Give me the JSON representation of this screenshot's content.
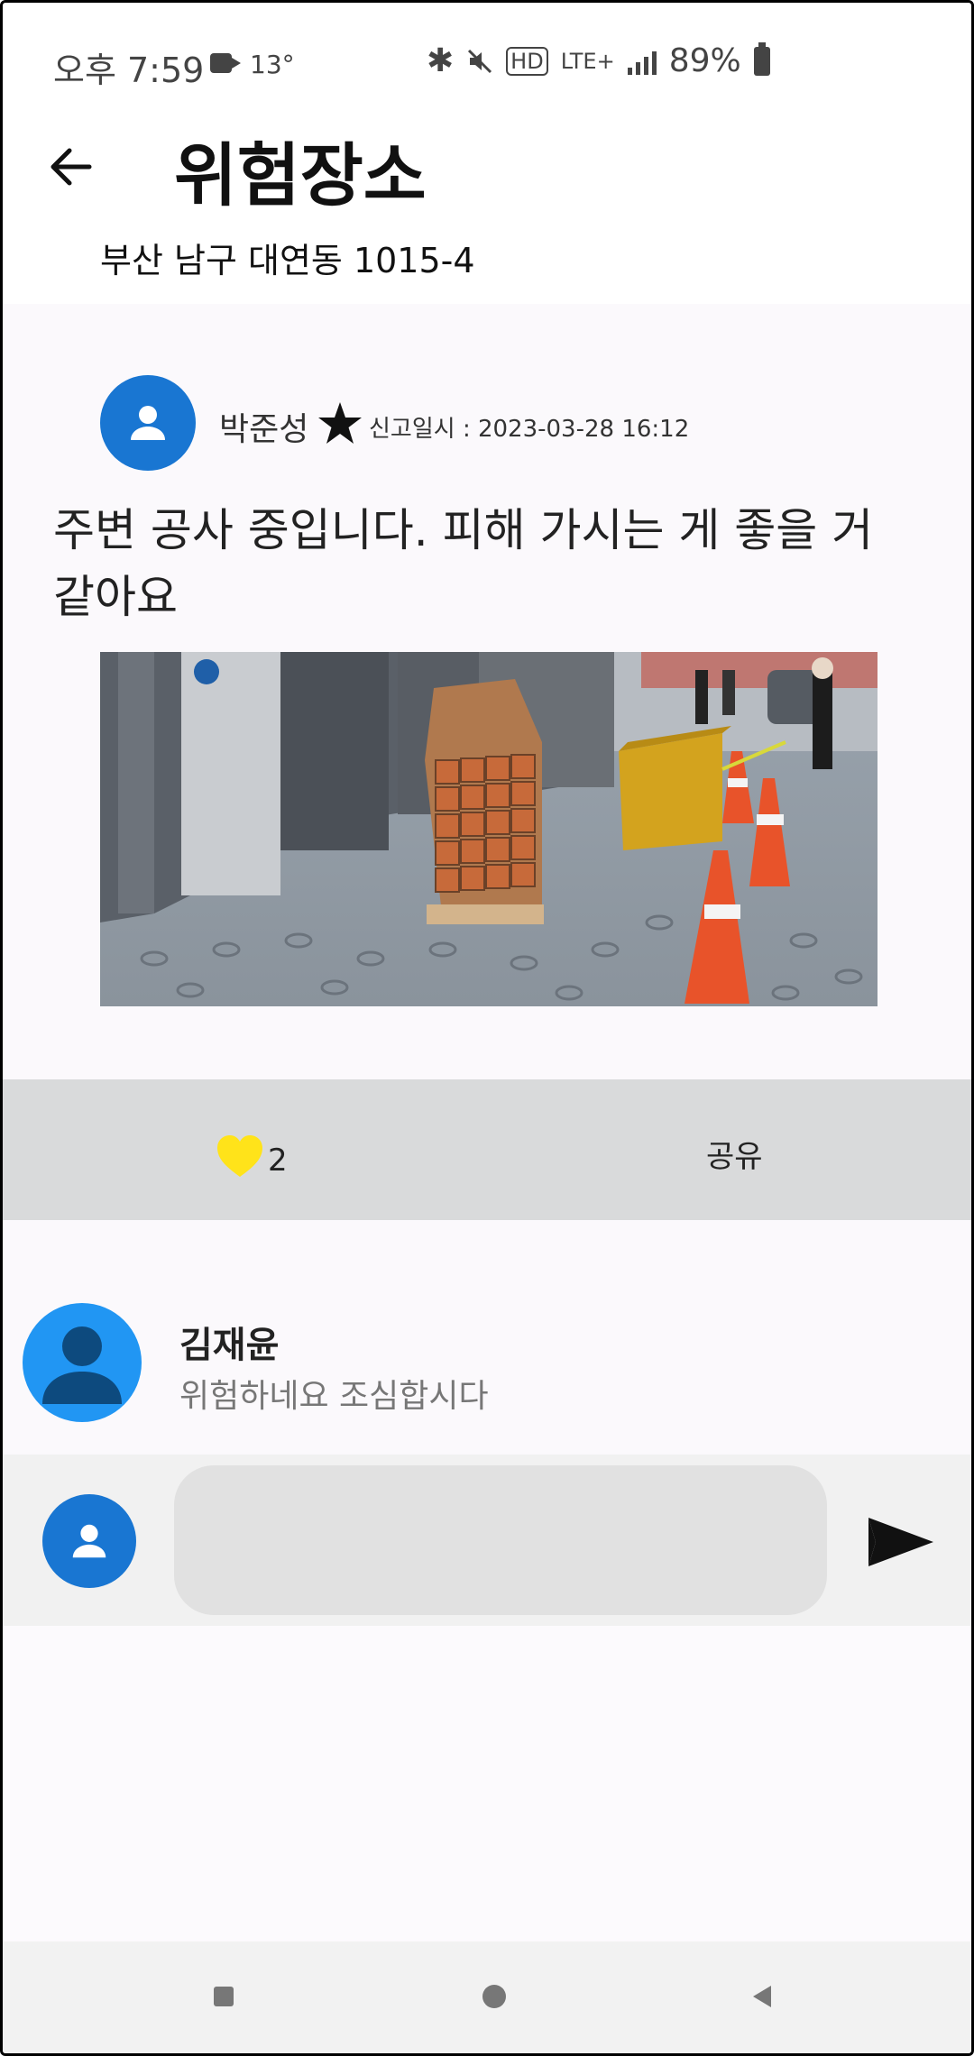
{
  "status_bar": {
    "time": "오후 7:59",
    "temperature": "13°",
    "network": "LTE+",
    "hd": "HD",
    "battery": "89%"
  },
  "header": {
    "title": "위험장소",
    "address": "부산 남구 대연동 1015-4"
  },
  "post": {
    "author": "박준성",
    "report_date": "신고일시 : 2023-03-28 16:12",
    "content": "주변 공사 중입니다. 피해 가시는 게 좋을 거 같아요"
  },
  "actions": {
    "like_count": "2",
    "share_label": "공유"
  },
  "comments": [
    {
      "name": "김재윤",
      "text": "위험하네요 조심합시다"
    }
  ],
  "comment_input": {
    "value": "",
    "placeholder": ""
  },
  "colors": {
    "avatar_blue": "#1976d2",
    "heart": "#ffe31a",
    "action_bar": "#d9dadb",
    "input_bg": "#e1e1e1"
  },
  "icons": [
    "back-arrow-icon",
    "star-icon",
    "heart-icon",
    "person-icon",
    "send-icon",
    "nav-recent-icon",
    "nav-home-icon",
    "nav-back-icon"
  ]
}
